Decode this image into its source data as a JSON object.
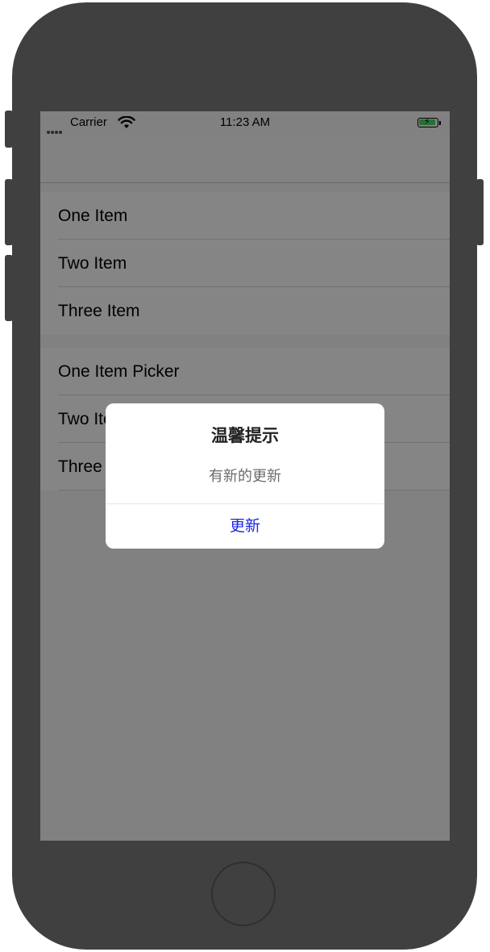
{
  "status_bar": {
    "carrier": "Carrier",
    "time": "11:23 AM"
  },
  "list": {
    "section1": [
      "One Item",
      "Two Item",
      "Three Item"
    ],
    "section2": [
      "One Item Picker",
      "Two Item Picker",
      "Three Item Picker"
    ]
  },
  "alert": {
    "title": "温馨提示",
    "message": "有新的更新",
    "action": "更新"
  },
  "colors": {
    "phone_frame": "#404040",
    "action_blue": "#1a27e0",
    "battery_green": "#4cd964"
  },
  "icons": [
    "wifi-icon",
    "battery-icon",
    "signal-icon"
  ]
}
